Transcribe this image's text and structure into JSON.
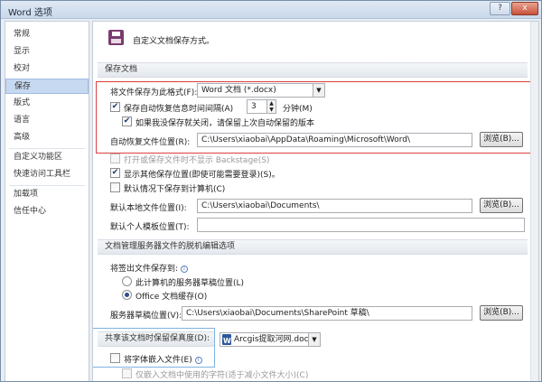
{
  "window": {
    "title": "Word 选项",
    "help_label": "?",
    "close_label": "x"
  },
  "nav": {
    "items": [
      {
        "label": "常规"
      },
      {
        "label": "显示"
      },
      {
        "label": "校对"
      },
      {
        "label": "保存"
      },
      {
        "label": "版式"
      },
      {
        "label": "语言"
      },
      {
        "label": "高级"
      },
      {
        "label": "自定义功能区"
      },
      {
        "label": "快速访问工具栏"
      },
      {
        "label": "加载项"
      },
      {
        "label": "信任中心"
      }
    ],
    "active": "保存"
  },
  "header": {
    "text": "自定义文档保存方式。"
  },
  "save_docs": {
    "title": "保存文档",
    "format_label": "将文件保存为此格式(F):",
    "format_value": "Word 文档 (*.docx)",
    "autorecover_label": "保存自动恢复信息时间间隔(A)",
    "autorecover_value": "3",
    "minutes_label": "分钟(M)",
    "keep_last_label": "如果我没保存就关闭，请保留上次自动保留的版本",
    "autorecover_location_label": "自动恢复文件位置(R):",
    "autorecover_location_value": "C:\\Users\\xiaobai\\AppData\\Roaming\\Microsoft\\Word\\",
    "browse_label": "浏览(B)...",
    "no_backstage_label": "打开或保存文件时不显示 Backstage(S)",
    "show_other_label": "显示其他保存位置(即使可能需要登录)(S)。",
    "default_computer_label": "默认情况下保存到计算机(C)",
    "default_local_label": "默认本地文件位置(I):",
    "default_local_value": "C:\\Users\\xiaobai\\Documents\\",
    "personal_template_label": "默认个人模板位置(T):",
    "personal_template_value": ""
  },
  "offline": {
    "title": "文档管理服务器文件的脱机编辑选项",
    "save_to_label": "将签出文件保存到:",
    "option_server_drafts": "此计算机的服务器草稿位置(L)",
    "option_office_cache": "Office 文档缓存(O)",
    "drafts_location_label": "服务器草稿位置(V):",
    "drafts_location_value": "C:\\Users\\xiaobai\\Documents\\SharePoint 草稿\\",
    "browse_label": "浏览(B)..."
  },
  "fidelity": {
    "title": "共享该文档时保留保真度(D):",
    "document": "Arcgis提取河网.docx",
    "embed_fonts_label": "将字体嵌入文件(E)",
    "embed_used_only_label": "仅嵌入文档中使用的字符(适于减小文件大小)(C)"
  }
}
